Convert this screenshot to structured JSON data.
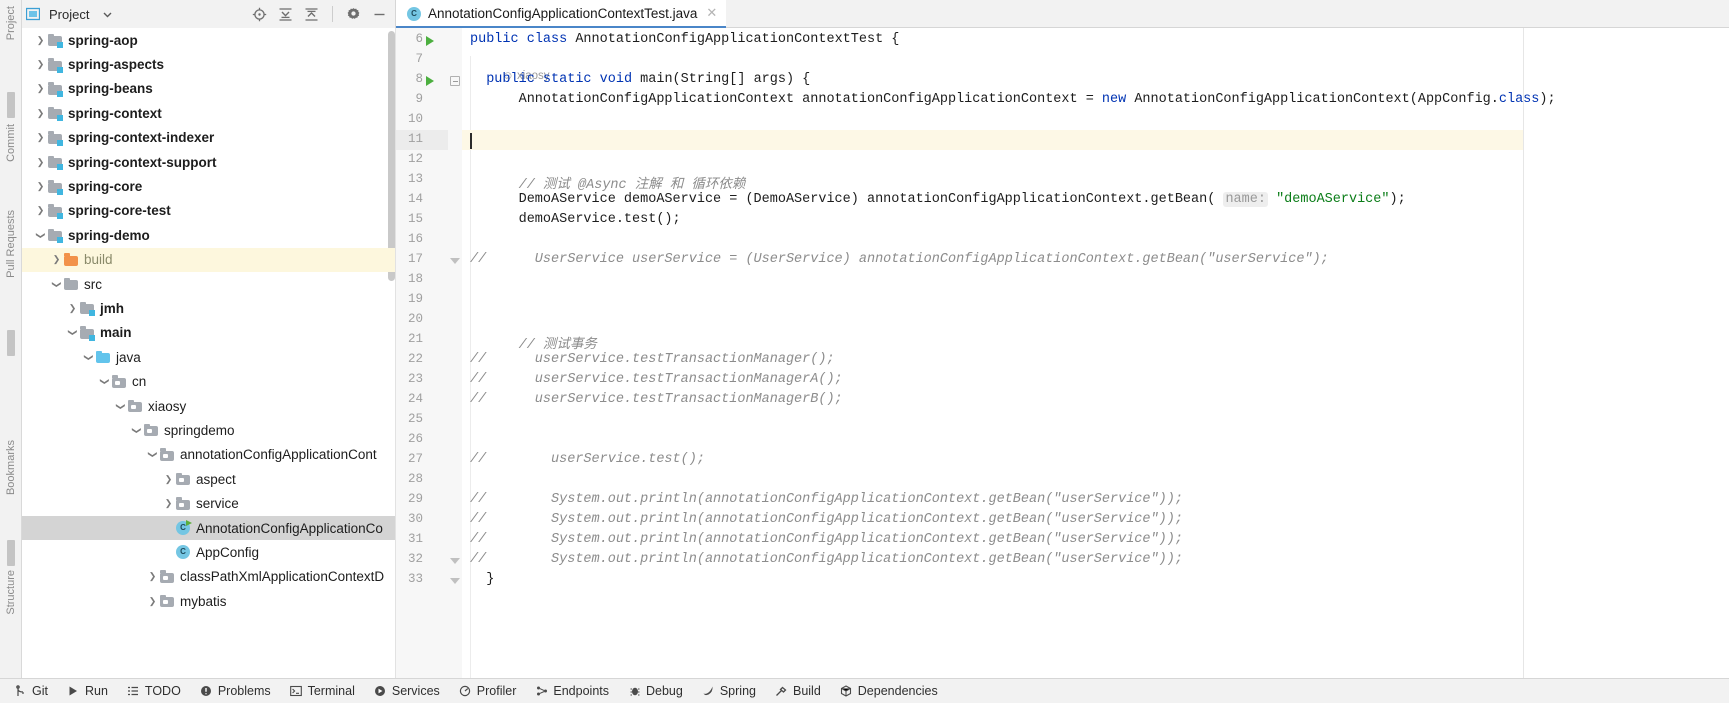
{
  "project_panel": {
    "title": "Project",
    "dropdown_icon": "chevron-down-icon",
    "panel_icon": "project-view-icon",
    "toolbar": [
      {
        "name": "select-opened-file-icon",
        "label": "Select Opened File"
      },
      {
        "name": "expand-all-icon",
        "label": "Expand All"
      },
      {
        "name": "collapse-all-icon",
        "label": "Collapse All"
      },
      {
        "name": "settings-gear-icon",
        "label": "Options"
      },
      {
        "name": "hide-icon",
        "label": "Hide"
      }
    ],
    "left_rail": [
      "Project",
      "Commit",
      "Pull Requests",
      "Bookmarks",
      "Structure"
    ]
  },
  "tree": {
    "items": [
      {
        "label": "spring-aop",
        "indent": 0,
        "arrow": "collapsed",
        "icon": "module",
        "bold": true,
        "state": "normal"
      },
      {
        "label": "spring-aspects",
        "indent": 0,
        "arrow": "collapsed",
        "icon": "module",
        "bold": true,
        "state": "normal"
      },
      {
        "label": "spring-beans",
        "indent": 0,
        "arrow": "collapsed",
        "icon": "module",
        "bold": true,
        "state": "normal"
      },
      {
        "label": "spring-context",
        "indent": 0,
        "arrow": "collapsed",
        "icon": "module",
        "bold": true,
        "state": "normal"
      },
      {
        "label": "spring-context-indexer",
        "indent": 0,
        "arrow": "collapsed",
        "icon": "module",
        "bold": true,
        "state": "normal"
      },
      {
        "label": "spring-context-support",
        "indent": 0,
        "arrow": "collapsed",
        "icon": "module",
        "bold": true,
        "state": "normal"
      },
      {
        "label": "spring-core",
        "indent": 0,
        "arrow": "collapsed",
        "icon": "module",
        "bold": true,
        "state": "normal"
      },
      {
        "label": "spring-core-test",
        "indent": 0,
        "arrow": "collapsed",
        "icon": "module",
        "bold": true,
        "state": "normal"
      },
      {
        "label": "spring-demo",
        "indent": 0,
        "arrow": "expanded",
        "icon": "module",
        "bold": true,
        "state": "normal"
      },
      {
        "label": "build",
        "indent": 1,
        "arrow": "collapsed",
        "icon": "excludedfolder",
        "bold": false,
        "state": "excluded"
      },
      {
        "label": "src",
        "indent": 1,
        "arrow": "expanded",
        "icon": "plainfolder",
        "bold": false,
        "state": "normal"
      },
      {
        "label": "jmh",
        "indent": 2,
        "arrow": "collapsed",
        "icon": "module",
        "bold": true,
        "state": "normal"
      },
      {
        "label": "main",
        "indent": 2,
        "arrow": "expanded",
        "icon": "module",
        "bold": true,
        "state": "normal"
      },
      {
        "label": "java",
        "indent": 3,
        "arrow": "expanded",
        "icon": "srcfolder",
        "bold": false,
        "state": "normal"
      },
      {
        "label": "cn",
        "indent": 4,
        "arrow": "expanded",
        "icon": "package",
        "bold": false,
        "state": "normal"
      },
      {
        "label": "xiaosy",
        "indent": 5,
        "arrow": "expanded",
        "icon": "package",
        "bold": false,
        "state": "normal"
      },
      {
        "label": "springdemo",
        "indent": 6,
        "arrow": "expanded",
        "icon": "package",
        "bold": false,
        "state": "normal"
      },
      {
        "label": "annotationConfigApplicationCont",
        "indent": 7,
        "arrow": "expanded",
        "icon": "package",
        "bold": false,
        "state": "normal"
      },
      {
        "label": "aspect",
        "indent": 8,
        "arrow": "collapsed",
        "icon": "package",
        "bold": false,
        "state": "normal"
      },
      {
        "label": "service",
        "indent": 8,
        "arrow": "collapsed",
        "icon": "package",
        "bold": false,
        "state": "normal"
      },
      {
        "label": "AnnotationConfigApplicationCo",
        "indent": 8,
        "arrow": "none",
        "icon": "javaclass-runnable",
        "bold": false,
        "state": "selected"
      },
      {
        "label": "AppConfig",
        "indent": 8,
        "arrow": "none",
        "icon": "javaclass",
        "bold": false,
        "state": "normal"
      },
      {
        "label": "classPathXmlApplicationContextD",
        "indent": 7,
        "arrow": "collapsed",
        "icon": "package",
        "bold": false,
        "state": "normal"
      },
      {
        "label": "mybatis",
        "indent": 7,
        "arrow": "collapsed",
        "icon": "package",
        "bold": false,
        "state": "normal"
      }
    ]
  },
  "editor": {
    "tab": {
      "label": "AnnotationConfigApplicationContextTest.java",
      "icon": "java-class-icon",
      "close_icon": "close-icon",
      "active": true
    },
    "code_vision": {
      "label": "xiaosy",
      "icon": "author-icon",
      "line": 7
    },
    "caret_line": 11,
    "lines": [
      {
        "n": 6,
        "run": true,
        "fold": "none",
        "segs": [
          {
            "t": "public ",
            "c": "kw"
          },
          {
            "t": "class ",
            "c": "kw"
          },
          {
            "t": "AnnotationConfigApplicationContextTest {",
            "c": "pl"
          }
        ]
      },
      {
        "n": 7,
        "run": false,
        "fold": "none",
        "segs": []
      },
      {
        "n": 8,
        "run": true,
        "fold": "minus",
        "segs": [
          {
            "t": "  ",
            "c": "pl"
          },
          {
            "t": "public ",
            "c": "kw"
          },
          {
            "t": "static ",
            "c": "kw"
          },
          {
            "t": "void ",
            "c": "kw"
          },
          {
            "t": "main(String[] args) {",
            "c": "pl"
          }
        ]
      },
      {
        "n": 9,
        "run": false,
        "fold": "none",
        "segs": [
          {
            "t": "      AnnotationConfigApplicationContext annotationConfigApplicationContext = ",
            "c": "pl"
          },
          {
            "t": "new ",
            "c": "kw"
          },
          {
            "t": "AnnotationConfigApplicationContext(AppConfig.",
            "c": "pl"
          },
          {
            "t": "class",
            "c": "kw"
          },
          {
            "t": ");",
            "c": "pl"
          }
        ]
      },
      {
        "n": 10,
        "run": false,
        "fold": "none",
        "segs": []
      },
      {
        "n": 11,
        "run": false,
        "fold": "none",
        "segs": []
      },
      {
        "n": 12,
        "run": false,
        "fold": "none",
        "segs": []
      },
      {
        "n": 13,
        "run": false,
        "fold": "none",
        "segs": [
          {
            "t": "      // 测试 @Async 注解 和 循环依赖",
            "c": "cm"
          }
        ]
      },
      {
        "n": 14,
        "run": false,
        "fold": "none",
        "segs": [
          {
            "t": "      DemoAService demoAService = (DemoAService) annotationConfigApplicationContext.getBean( ",
            "c": "pl"
          },
          {
            "t": "name:",
            "c": "hintbg"
          },
          {
            "t": " ",
            "c": "pl"
          },
          {
            "t": "\"demoAService\"",
            "c": "str"
          },
          {
            "t": ");",
            "c": "pl"
          }
        ]
      },
      {
        "n": 15,
        "run": false,
        "fold": "none",
        "segs": [
          {
            "t": "      demoAService.test();",
            "c": "pl"
          }
        ]
      },
      {
        "n": 16,
        "run": false,
        "fold": "none",
        "segs": []
      },
      {
        "n": 17,
        "run": false,
        "fold": "end",
        "segs": [
          {
            "t": "//",
            "c": "cm"
          },
          {
            "t": "      UserService userService = (UserService) annotationConfigApplicationContext.getBean(\"userService\");",
            "c": "cm"
          }
        ],
        "comment_gutter": true
      },
      {
        "n": 18,
        "run": false,
        "fold": "none",
        "segs": []
      },
      {
        "n": 19,
        "run": false,
        "fold": "none",
        "segs": []
      },
      {
        "n": 20,
        "run": false,
        "fold": "none",
        "segs": []
      },
      {
        "n": 21,
        "run": false,
        "fold": "none",
        "segs": [
          {
            "t": "      // 测试事务",
            "c": "cm"
          }
        ]
      },
      {
        "n": 22,
        "run": false,
        "fold": "none",
        "segs": [
          {
            "t": "//",
            "c": "cm"
          },
          {
            "t": "      userService.testTransactionManager();",
            "c": "cm"
          }
        ],
        "comment_gutter": true
      },
      {
        "n": 23,
        "run": false,
        "fold": "none",
        "segs": [
          {
            "t": "//",
            "c": "cm"
          },
          {
            "t": "      userService.testTransactionManagerA();",
            "c": "cm"
          }
        ],
        "comment_gutter": true
      },
      {
        "n": 24,
        "run": false,
        "fold": "none",
        "segs": [
          {
            "t": "//",
            "c": "cm"
          },
          {
            "t": "      userService.testTransactionManagerB();",
            "c": "cm"
          }
        ],
        "comment_gutter": true
      },
      {
        "n": 25,
        "run": false,
        "fold": "none",
        "segs": []
      },
      {
        "n": 26,
        "run": false,
        "fold": "none",
        "segs": []
      },
      {
        "n": 27,
        "run": false,
        "fold": "none",
        "segs": [
          {
            "t": "//",
            "c": "cm"
          },
          {
            "t": "        userService.test();",
            "c": "cm"
          }
        ],
        "comment_gutter": true
      },
      {
        "n": 28,
        "run": false,
        "fold": "none",
        "segs": []
      },
      {
        "n": 29,
        "run": false,
        "fold": "none",
        "segs": [
          {
            "t": "//",
            "c": "cm"
          },
          {
            "t": "        System.out.println(annotationConfigApplicationContext.getBean(\"userService\"));",
            "c": "cm"
          }
        ],
        "comment_gutter": true
      },
      {
        "n": 30,
        "run": false,
        "fold": "none",
        "segs": [
          {
            "t": "//",
            "c": "cm"
          },
          {
            "t": "        System.out.println(annotationConfigApplicationContext.getBean(\"userService\"));",
            "c": "cm"
          }
        ],
        "comment_gutter": true
      },
      {
        "n": 31,
        "run": false,
        "fold": "none",
        "segs": [
          {
            "t": "//",
            "c": "cm"
          },
          {
            "t": "        System.out.println(annotationConfigApplicationContext.getBean(\"userService\"));",
            "c": "cm"
          }
        ],
        "comment_gutter": true
      },
      {
        "n": 32,
        "run": false,
        "fold": "end",
        "segs": [
          {
            "t": "//",
            "c": "cm"
          },
          {
            "t": "        System.out.println(annotationConfigApplicationContext.getBean(\"userService\"));",
            "c": "cm"
          }
        ],
        "comment_gutter": true
      },
      {
        "n": 33,
        "run": false,
        "fold": "endtri",
        "segs": [
          {
            "t": "  }",
            "c": "pl"
          }
        ]
      }
    ]
  },
  "statusbar": {
    "items": [
      {
        "label": "Git",
        "icon": "git-branch-icon"
      },
      {
        "label": "Run",
        "icon": "run-icon"
      },
      {
        "label": "TODO",
        "icon": "todo-list-icon"
      },
      {
        "label": "Problems",
        "icon": "problems-icon"
      },
      {
        "label": "Terminal",
        "icon": "terminal-icon"
      },
      {
        "label": "Services",
        "icon": "services-icon"
      },
      {
        "label": "Profiler",
        "icon": "profiler-icon"
      },
      {
        "label": "Endpoints",
        "icon": "endpoints-icon"
      },
      {
        "label": "Debug",
        "icon": "debug-icon"
      },
      {
        "label": "Spring",
        "icon": "spring-leaf-icon"
      },
      {
        "label": "Build",
        "icon": "build-hammer-icon"
      },
      {
        "label": "Dependencies",
        "icon": "dependencies-icon"
      }
    ]
  },
  "colors": {
    "accent": "#4a86c8",
    "keyword": "#0033b3",
    "string": "#0b7d18",
    "comment": "#8c8c8c",
    "selection": "#d4d4d4",
    "caret_line": "#fdf8e6",
    "excluded_row": "#fdf7dd",
    "run_marker": "#4caf3f"
  }
}
